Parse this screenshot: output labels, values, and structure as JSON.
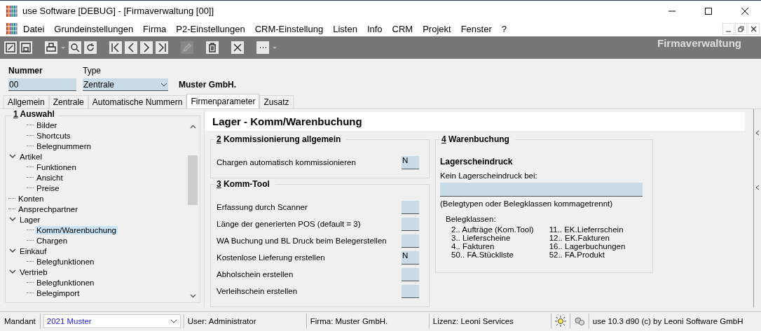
{
  "window": {
    "title": "use Software [DEBUG] - [Firmaverwaltung [00]]"
  },
  "menu": [
    "Datei",
    "Grundeinstellungen",
    "Firma",
    "P2-Einstellungen",
    "CRM-Einstellung",
    "Listen",
    "Info",
    "CRM",
    "Projekt",
    "Fenster",
    "?"
  ],
  "toolbar": {
    "title": "Firmaverwaltung"
  },
  "header": {
    "nummer_label": "Nummer",
    "nummer_value": "00",
    "type_label": "Type",
    "type_value": "Zentrale",
    "company": "Muster GmbH."
  },
  "tabs": [
    {
      "label": "Allgemein",
      "selected": false
    },
    {
      "label": "Zentrale",
      "selected": false
    },
    {
      "label": "Automatische Nummern",
      "selected": false
    },
    {
      "label": "Firmenparameter",
      "selected": true
    },
    {
      "label": "Zusatz",
      "selected": false
    }
  ],
  "tree": {
    "number": "1",
    "title": "Auswahl",
    "items": [
      {
        "children": [
          {
            "label": "Bilder",
            "selected": false
          },
          {
            "label": "Shortcuts",
            "selected": false
          },
          {
            "label": "Belegnummern",
            "selected": false
          }
        ]
      },
      {
        "label": "Artikel",
        "selected": false,
        "expanded": true,
        "children": [
          {
            "label": "Funktionen",
            "selected": false
          },
          {
            "label": "Ansicht",
            "selected": false
          },
          {
            "label": "Preise",
            "selected": false
          }
        ]
      },
      {
        "label": "Konten",
        "selected": false
      },
      {
        "label": "Ansprechpartner",
        "selected": false
      },
      {
        "label": "Lager",
        "selected": false,
        "expanded": true,
        "children": [
          {
            "label": "Komm/Warenbuchung",
            "selected": true
          },
          {
            "label": "Chargen",
            "selected": false
          }
        ]
      },
      {
        "label": "Einkauf",
        "selected": false,
        "expanded": true,
        "children": [
          {
            "label": "Belegfunktionen",
            "selected": false
          }
        ]
      },
      {
        "label": "Vertrieb",
        "selected": false,
        "expanded": true,
        "children": [
          {
            "label": "Belegfunktionen",
            "selected": false
          },
          {
            "label": "Belegimport",
            "selected": false
          }
        ]
      }
    ]
  },
  "page_title": "Lager - Komm/Warenbuchung",
  "groups": [
    {
      "number": "2",
      "title": "Kommissionierung allgemein",
      "rows": [
        {
          "label": "Chargen automatisch kommissionieren",
          "value": "N"
        }
      ]
    },
    {
      "number": "3",
      "title": "Komm-Tool",
      "rows": [
        {
          "label": "Erfassung durch Scanner"
        },
        {
          "label": "Länge der generierten POS (default = 3)"
        },
        {
          "label": "WA Buchung und BL Druck beim Belegerstellen"
        },
        {
          "label": "Kostenlose Lieferung erstellen",
          "value": "N"
        },
        {
          "label": "Abholschein erstellen"
        },
        {
          "label": "Verleihschein erstellen"
        }
      ]
    }
  ],
  "warenbuchung": {
    "number": "4",
    "title": "Warenbuchung",
    "subtitle": "Lagerscheindruck",
    "field_label": "Kein Lagerscheindruck bei:",
    "hint": "(Belegtypen oder Belegklassen kommagetrennt)",
    "classes_label": "Belegklassen:",
    "classes_left": [
      "2.. Aufträge (Kom.Tool)",
      "3.. Lieferscheine",
      "4.. Fakturen",
      "50.. FA.Stückliste"
    ],
    "classes_right": [
      "11.. EK.Lieferrschein",
      "12.. EK.Fakturen",
      "16.. Lagerbuchungen",
      "52.. FA.Produkt"
    ]
  },
  "status_bar": {
    "mandant_label": "Mandant",
    "mandant_value": "2021 Muster",
    "user": "User: Administrator",
    "firma": "Firma: Muster GmbH.",
    "lizenz": "Lizenz: Leoni Services",
    "version": "use 10.3 d90 (c) by Leoni Software GmbH"
  }
}
